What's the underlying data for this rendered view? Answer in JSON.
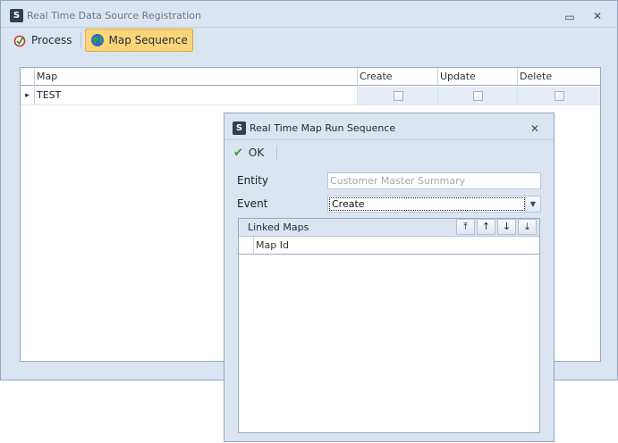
{
  "main_window": {
    "title": "Real Time Data Source Registration",
    "minimize_glyph": "▭",
    "close_glyph": "✕",
    "icon_glyph": "S"
  },
  "toolbar": {
    "process_label": "Process",
    "map_sequence_label": "Map Sequence"
  },
  "grid": {
    "columns": [
      "Map",
      "Create",
      "Update",
      "Delete"
    ],
    "rows": [
      {
        "map": "TEST",
        "create": false,
        "update": false,
        "delete": false
      }
    ],
    "row_indicator_glyph": "▸"
  },
  "dialog": {
    "title": "Real Time Map Run Sequence",
    "close_glyph": "✕",
    "icon_glyph": "S",
    "ok_label": "OK",
    "ok_glyph": "✔",
    "entity_label": "Entity",
    "entity_value": "Customer Master Summary",
    "event_label": "Event",
    "event_value": "Create",
    "dropdown_glyph": "▼",
    "linked_maps_label": "Linked Maps",
    "linked_maps_column": "Map Id",
    "move_buttons": [
      "⤒",
      "↑",
      "↓",
      "⤓"
    ]
  }
}
